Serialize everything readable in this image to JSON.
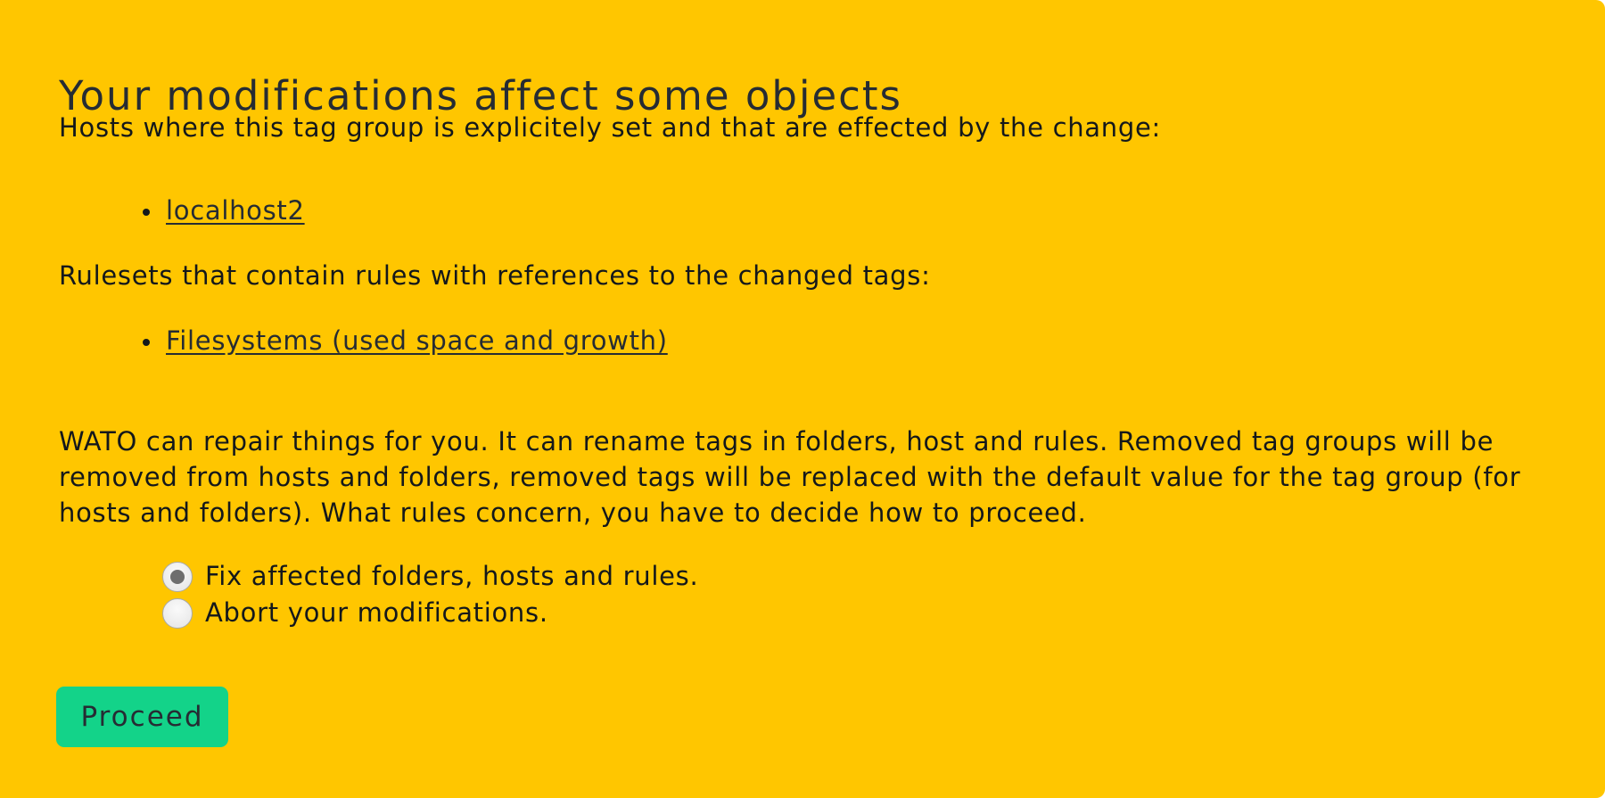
{
  "dialog": {
    "title": "Your modifications affect some objects",
    "hosts_intro": "Hosts where this tag group is explicitely set and that are effected by the change:",
    "hosts": [
      "localhost2"
    ],
    "rulesets_intro": "Rulesets that contain rules with references to the changed tags:",
    "rulesets": [
      "Filesystems (used space and growth)"
    ],
    "repair_text": "WATO can repair things for you. It can rename tags in folders, host and rules. Removed tag groups will be removed from hosts and folders, removed tags will be replaced with the default value for the tag group (for hosts and folders). What rules concern, you have to decide how to proceed.",
    "options": [
      {
        "label": "Fix affected folders, hosts and rules.",
        "selected": true
      },
      {
        "label": "Abort your modifications.",
        "selected": false
      }
    ],
    "proceed_label": "Proceed"
  },
  "colors": {
    "panel_background": "#ffc600",
    "button_background": "#13d389",
    "text": "#14181b"
  }
}
